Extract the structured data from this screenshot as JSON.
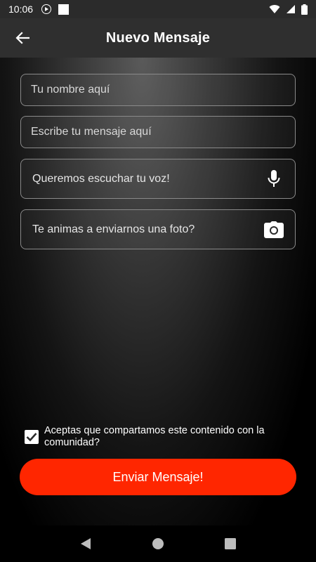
{
  "status_bar": {
    "time": "10:06"
  },
  "header": {
    "title": "Nuevo Mensaje"
  },
  "form": {
    "name_placeholder": "Tu nombre aquí",
    "message_placeholder": "Escribe tu mensaje aquí",
    "voice_label": "Queremos escuchar tu voz!",
    "photo_label": "Te animas a enviarnos una foto?"
  },
  "consent": {
    "label": "Aceptas que compartamos este contenido con la comunidad?",
    "checked": true
  },
  "send_button": {
    "label": "Enviar Mensaje!"
  },
  "colors": {
    "accent": "#ff2600",
    "app_bar": "#2f2f2f"
  },
  "icons": {
    "back": "arrow-left-icon",
    "voice": "microphone-icon",
    "photo": "camera-icon",
    "nav_back": "triangle-back-icon",
    "nav_home": "circle-home-icon",
    "nav_recents": "square-recents-icon"
  }
}
